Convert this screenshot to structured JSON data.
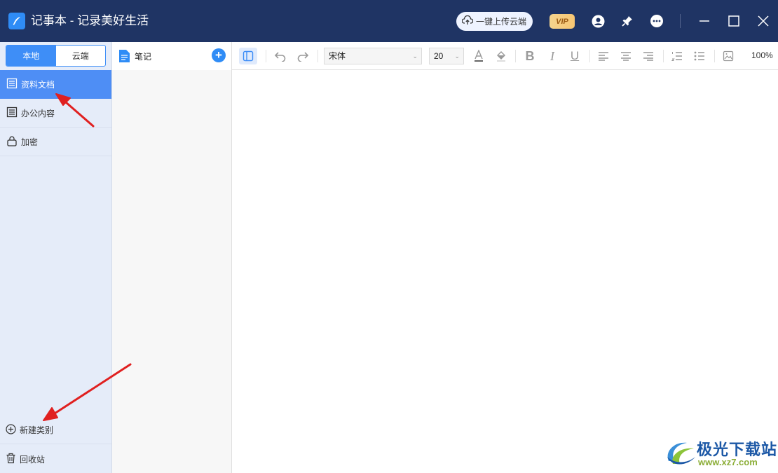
{
  "window": {
    "title": "记事本 - 记录美好生活",
    "upload_label": "一键上传云端",
    "vip_label": "VIP"
  },
  "sidebar": {
    "tabs": [
      {
        "label": "本地",
        "active": true
      },
      {
        "label": "云端",
        "active": false
      }
    ],
    "categories": [
      {
        "label": "资料文档",
        "icon": "document-list-icon",
        "active": true
      },
      {
        "label": "办公内容",
        "icon": "document-list-icon",
        "active": false
      },
      {
        "label": "加密",
        "icon": "lock-icon",
        "active": false
      }
    ],
    "new_category_label": "新建类别",
    "recycle_label": "回收站"
  },
  "notes": {
    "title": "笔记"
  },
  "toolbar": {
    "font_family": "宋体",
    "font_size": "20",
    "zoom": "100%"
  },
  "watermark": {
    "title": "极光下载站",
    "url": "www.xz7.com"
  },
  "colors": {
    "titlebar": "#1f3464",
    "accent": "#3e8ef7",
    "sidebar_bg": "#e5ecf9",
    "annotation_arrow": "#e02020"
  }
}
